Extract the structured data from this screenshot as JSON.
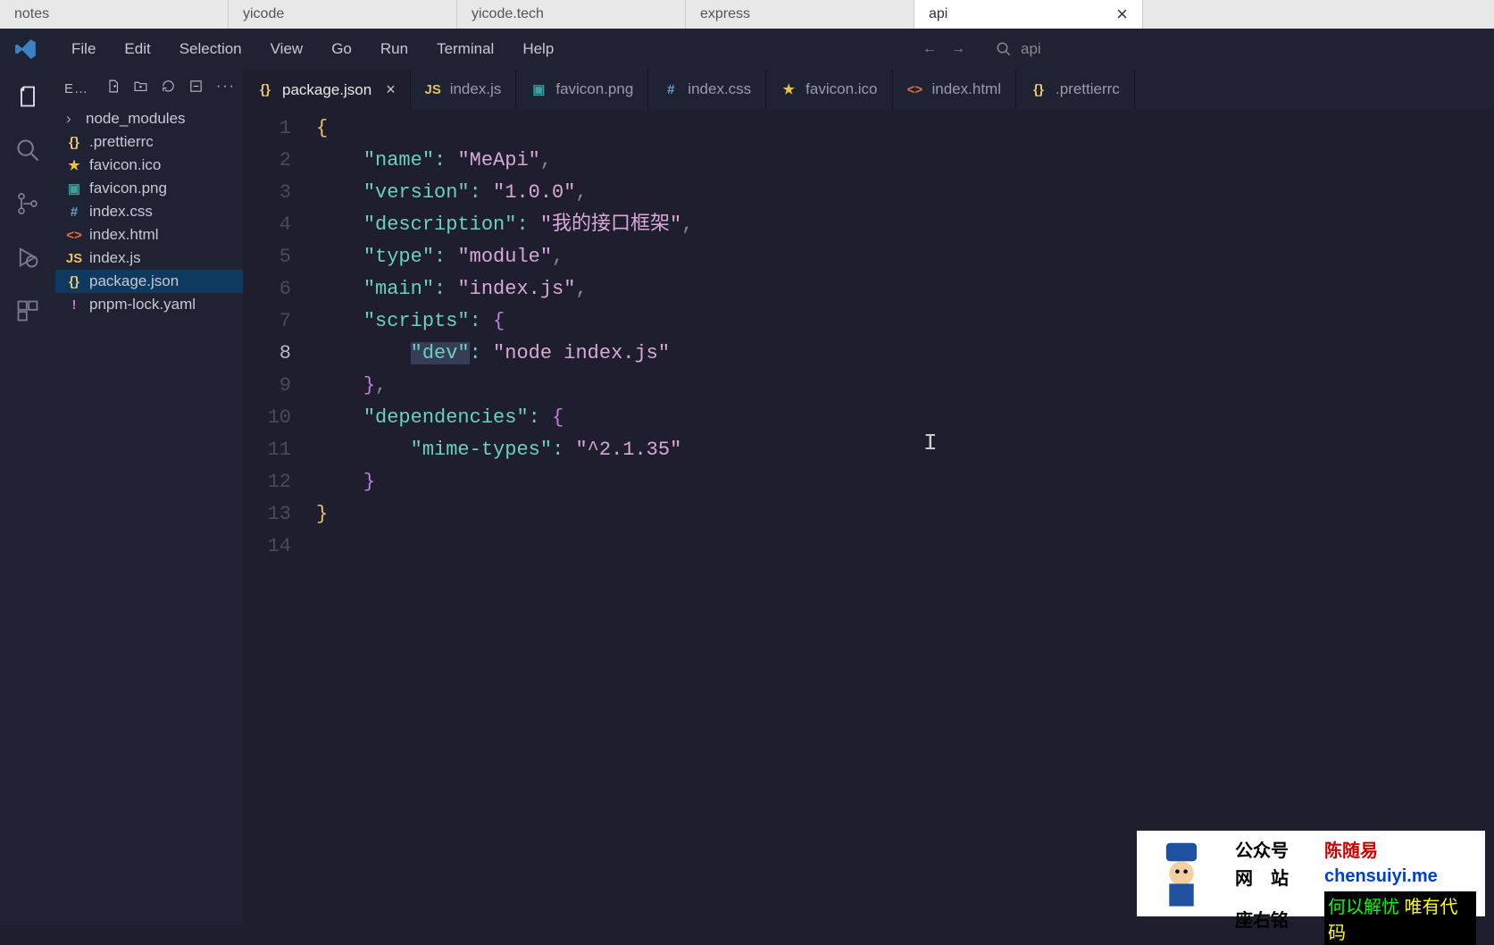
{
  "browserTabs": [
    {
      "label": "notes",
      "active": false
    },
    {
      "label": "yicode",
      "active": false
    },
    {
      "label": "yicode.tech",
      "active": false
    },
    {
      "label": "express",
      "active": false
    },
    {
      "label": "api",
      "active": true
    }
  ],
  "menu": [
    "File",
    "Edit",
    "Selection",
    "View",
    "Go",
    "Run",
    "Terminal",
    "Help"
  ],
  "searchPlaceholder": "api",
  "explorerLabel": "E…",
  "files": [
    {
      "name": "node_modules",
      "icon": "folder",
      "chev": true
    },
    {
      "name": ".prettierrc",
      "icon": "json"
    },
    {
      "name": "favicon.ico",
      "icon": "star"
    },
    {
      "name": "favicon.png",
      "icon": "img"
    },
    {
      "name": "index.css",
      "icon": "css"
    },
    {
      "name": "index.html",
      "icon": "html"
    },
    {
      "name": "index.js",
      "icon": "js"
    },
    {
      "name": "package.json",
      "icon": "json",
      "selected": true
    },
    {
      "name": "pnpm-lock.yaml",
      "icon": "yaml"
    }
  ],
  "editorTabs": [
    {
      "name": "package.json",
      "icon": "json",
      "active": true,
      "close": true
    },
    {
      "name": "index.js",
      "icon": "js"
    },
    {
      "name": "favicon.png",
      "icon": "img"
    },
    {
      "name": "index.css",
      "icon": "css"
    },
    {
      "name": "favicon.ico",
      "icon": "star"
    },
    {
      "name": "index.html",
      "icon": "html"
    },
    {
      "name": ".prettierrc",
      "icon": "json"
    }
  ],
  "lineNumbers": [
    "1",
    "2",
    "3",
    "4",
    "5",
    "6",
    "7",
    "8",
    "9",
    "10",
    "11",
    "12",
    "13",
    "14"
  ],
  "currentLine": 8,
  "code": {
    "name_k": "\"name\"",
    "name_v": "\"MeApi\"",
    "version_k": "\"version\"",
    "version_v": "\"1.0.0\"",
    "desc_k": "\"description\"",
    "desc_v": "\"我的接口框架\"",
    "type_k": "\"type\"",
    "type_v": "\"module\"",
    "main_k": "\"main\"",
    "main_v": "\"index.js\"",
    "scripts_k": "\"scripts\"",
    "dev_k": "\"dev\"",
    "dev_v": "\"node index.js\"",
    "deps_k": "\"dependencies\"",
    "mime_k": "\"mime-types\"",
    "mime_v": "\"^2.1.35\""
  },
  "watermark": {
    "k1": "公众号",
    "v1": "陈随易",
    "k2": "网　站",
    "v2": "chensuiyi.me",
    "k3": "座右铭",
    "m1": "何以解忧",
    "m2": "唯有代码"
  }
}
